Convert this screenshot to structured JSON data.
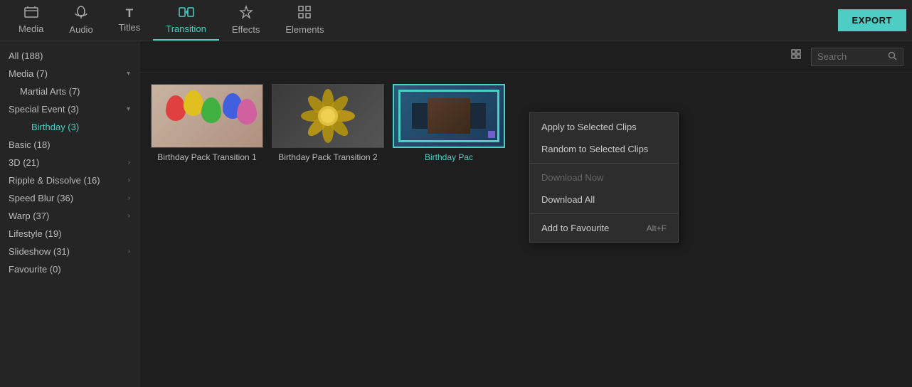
{
  "app": {
    "export_label": "EXPORT"
  },
  "nav": {
    "items": [
      {
        "id": "media",
        "label": "Media",
        "icon": "🗂",
        "active": false
      },
      {
        "id": "audio",
        "label": "Audio",
        "icon": "♪",
        "active": false
      },
      {
        "id": "titles",
        "label": "Titles",
        "icon": "T",
        "active": false
      },
      {
        "id": "transition",
        "label": "Transition",
        "icon": "↔",
        "active": true
      },
      {
        "id": "effects",
        "label": "Effects",
        "icon": "✦",
        "active": false
      },
      {
        "id": "elements",
        "label": "Elements",
        "icon": "⊞",
        "active": false
      }
    ]
  },
  "sidebar": {
    "items": [
      {
        "id": "all",
        "label": "All (188)",
        "indent": 0,
        "expandable": false,
        "active": false
      },
      {
        "id": "media",
        "label": "Media (7)",
        "indent": 0,
        "expandable": true,
        "active": false
      },
      {
        "id": "martial-arts",
        "label": "Martial Arts (7)",
        "indent": 1,
        "expandable": false,
        "active": false
      },
      {
        "id": "special-event",
        "label": "Special Event (3)",
        "indent": 0,
        "expandable": true,
        "active": false
      },
      {
        "id": "birthday",
        "label": "Birthday (3)",
        "indent": 2,
        "expandable": false,
        "active": true
      },
      {
        "id": "basic",
        "label": "Basic (18)",
        "indent": 0,
        "expandable": false,
        "active": false
      },
      {
        "id": "3d",
        "label": "3D (21)",
        "indent": 0,
        "expandable": true,
        "active": false
      },
      {
        "id": "ripple",
        "label": "Ripple & Dissolve (16)",
        "indent": 0,
        "expandable": true,
        "active": false
      },
      {
        "id": "speed-blur",
        "label": "Speed Blur (36)",
        "indent": 0,
        "expandable": true,
        "active": false
      },
      {
        "id": "warp",
        "label": "Warp (37)",
        "indent": 0,
        "expandable": true,
        "active": false
      },
      {
        "id": "lifestyle",
        "label": "Lifestyle (19)",
        "indent": 0,
        "expandable": false,
        "active": false
      },
      {
        "id": "slideshow",
        "label": "Slideshow (31)",
        "indent": 0,
        "expandable": true,
        "active": false
      },
      {
        "id": "favourite",
        "label": "Favourite (0)",
        "indent": 0,
        "expandable": false,
        "active": false
      }
    ]
  },
  "toolbar": {
    "search_placeholder": "Search"
  },
  "grid": {
    "items": [
      {
        "id": "bpt1",
        "label": "Birthday Pack Transition 1",
        "selected": false,
        "thumb_type": "balloons"
      },
      {
        "id": "bpt2",
        "label": "Birthday Pack Transition 2",
        "selected": false,
        "thumb_type": "flower"
      },
      {
        "id": "bpt3",
        "label": "Birthday Pac",
        "selected": true,
        "thumb_type": "frame"
      }
    ]
  },
  "context_menu": {
    "items": [
      {
        "id": "apply-selected",
        "label": "Apply to Selected Clips",
        "shortcut": "",
        "disabled": false
      },
      {
        "id": "random-selected",
        "label": "Random to Selected Clips",
        "shortcut": "",
        "disabled": false
      },
      {
        "id": "divider1",
        "type": "divider"
      },
      {
        "id": "download-now",
        "label": "Download Now",
        "shortcut": "",
        "disabled": true
      },
      {
        "id": "download-all",
        "label": "Download All",
        "shortcut": "",
        "disabled": false
      },
      {
        "id": "divider2",
        "type": "divider"
      },
      {
        "id": "add-favourite",
        "label": "Add to Favourite",
        "shortcut": "Alt+F",
        "disabled": false
      }
    ]
  }
}
